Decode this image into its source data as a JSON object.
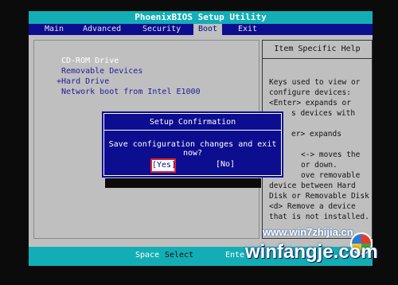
{
  "window": {
    "title": "PhoenixBIOS Setup Utility"
  },
  "menu": {
    "items": [
      "Main",
      "Advanced",
      "Security",
      "Boot",
      "Exit"
    ],
    "active": "Boot"
  },
  "boot": {
    "items": [
      "CD-ROM Drive",
      "Removable Devices",
      "+Hard Drive",
      "Network boot from Intel E1000"
    ]
  },
  "help": {
    "title": "Item Specific Help",
    "lines": [
      "Keys used to view or",
      "configure devices:",
      "<Enter> expands or",
      "s devices with",
      "",
      "er> expands",
      "",
      "<-> moves the",
      "or down.",
      "ove removable",
      "device between Hard",
      "Disk or Removable Disk",
      "<d> Remove a device",
      "that is not installed."
    ]
  },
  "dialog": {
    "title": "Setup Confirmation",
    "message": "Save configuration changes and exit now?",
    "yes_label": "[Yes]",
    "no_label": "[No]"
  },
  "footer": {
    "key1": "Space",
    "action1": "Select",
    "key2": "Ente"
  },
  "watermark": {
    "site": "www.win7zhijia.cn",
    "brand": "winfangje.com"
  },
  "colors": {
    "accent": "#13aeb5",
    "menubar": "#0d0d8f",
    "highlight": "#e0222a"
  }
}
